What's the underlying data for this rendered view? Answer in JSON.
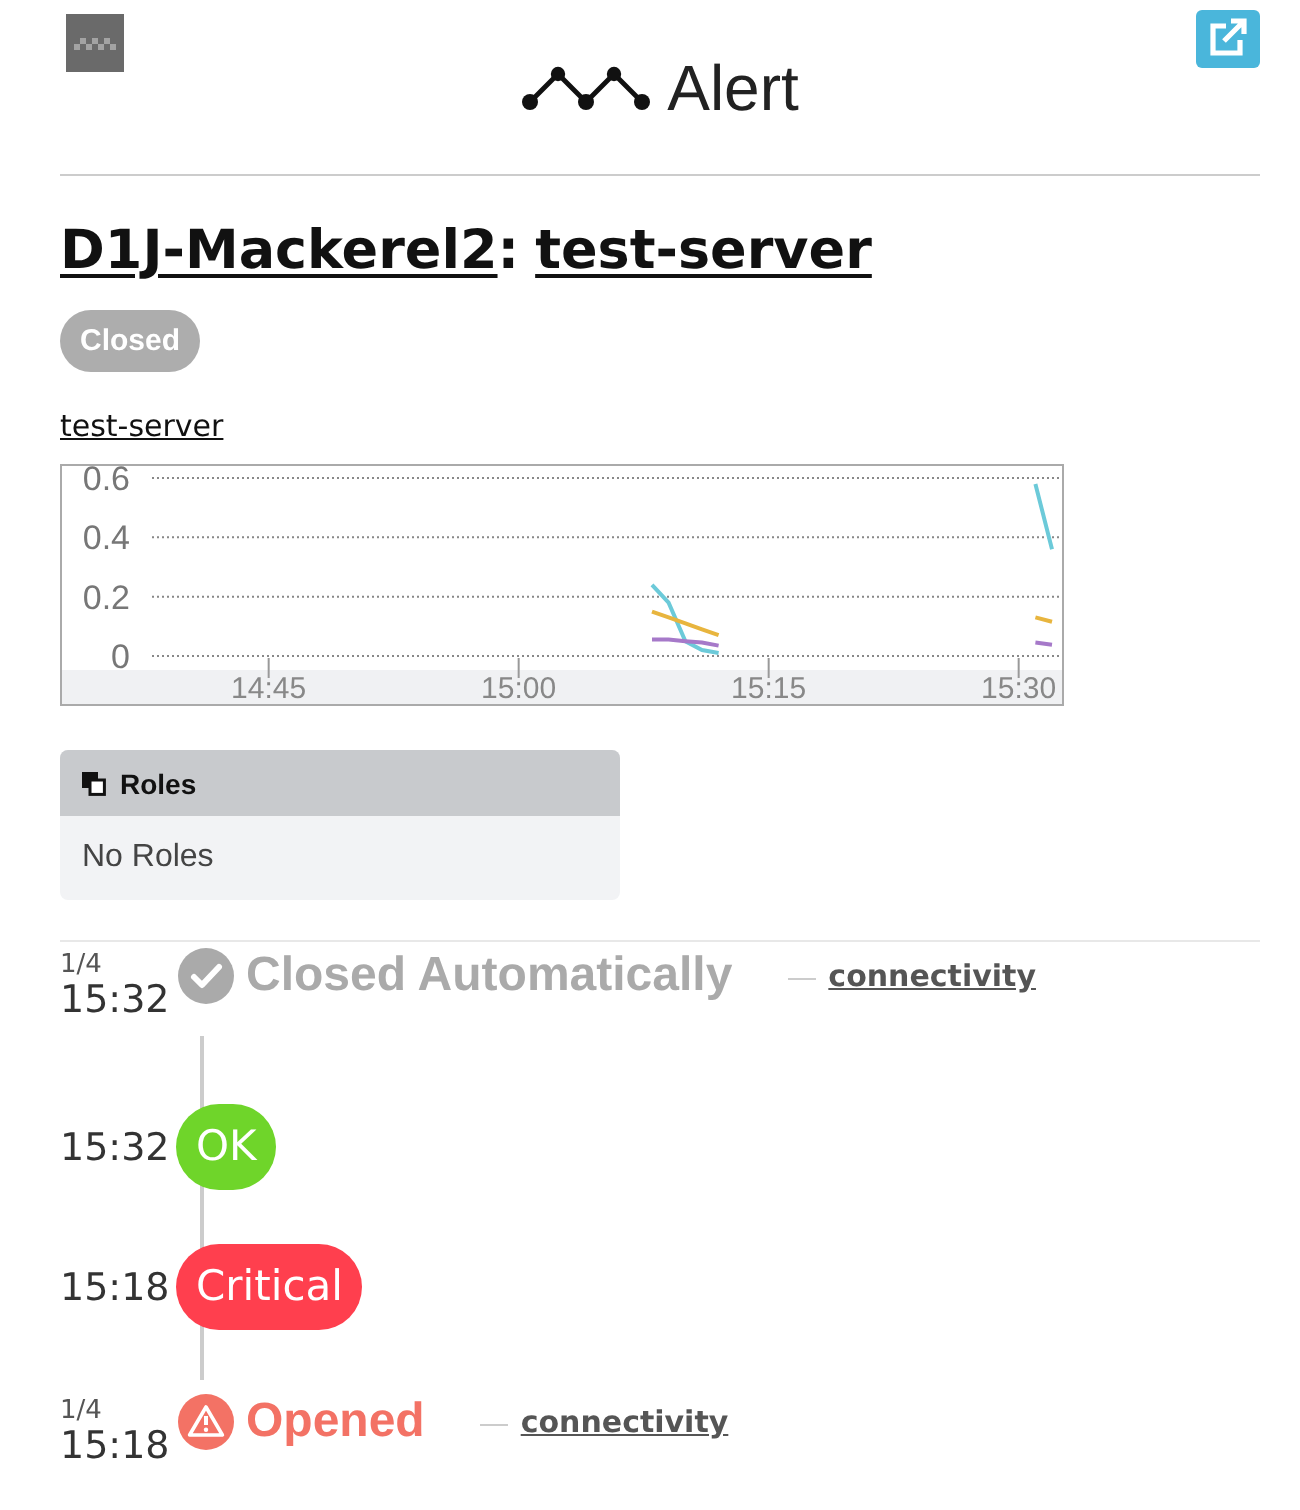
{
  "header": {
    "title": "Alert"
  },
  "alert": {
    "organization": "D1J-Mackerel2",
    "separator": ":",
    "host": "test-server",
    "status": {
      "kind": "closed",
      "label": "Closed"
    }
  },
  "graph": {
    "host_link": "test-server",
    "chart_data": {
      "type": "line",
      "categories": [
        null,
        null,
        null,
        null,
        null,
        null,
        null,
        "14:45",
        null,
        null,
        null,
        null,
        null,
        null,
        null,
        null,
        null,
        null,
        null,
        null,
        null,
        null,
        "15:00",
        null,
        null,
        null,
        null,
        null,
        null,
        null,
        null,
        null,
        null,
        null,
        null,
        null,
        null,
        "15:15",
        null,
        null,
        null,
        null,
        null,
        null,
        null,
        null,
        null,
        null,
        null,
        null,
        null,
        null,
        "15:30",
        null,
        null
      ],
      "ylim": [
        0,
        0.6
      ],
      "yticks": [
        0,
        0.2,
        0.4,
        0.6
      ],
      "series": [
        {
          "color": "#6ccad9",
          "values": [
            null,
            null,
            null,
            null,
            null,
            null,
            null,
            null,
            null,
            null,
            null,
            null,
            null,
            null,
            null,
            null,
            null,
            null,
            null,
            null,
            null,
            null,
            null,
            null,
            null,
            null,
            null,
            null,
            null,
            null,
            0.24,
            0.18,
            0.05,
            0.02,
            0.01,
            null,
            null,
            null,
            null,
            null,
            null,
            null,
            null,
            null,
            null,
            null,
            null,
            null,
            null,
            null,
            null,
            null,
            null,
            0.58,
            0.36
          ]
        },
        {
          "color": "#e8b53e",
          "values": [
            null,
            null,
            null,
            null,
            null,
            null,
            null,
            null,
            null,
            null,
            null,
            null,
            null,
            null,
            null,
            null,
            null,
            null,
            null,
            null,
            null,
            null,
            null,
            null,
            null,
            null,
            null,
            null,
            null,
            null,
            0.15,
            0.13,
            0.11,
            0.09,
            0.07,
            null,
            null,
            null,
            null,
            null,
            null,
            null,
            null,
            null,
            null,
            null,
            null,
            null,
            null,
            null,
            null,
            null,
            null,
            0.13,
            0.115
          ]
        },
        {
          "color": "#a679c9",
          "values": [
            null,
            null,
            null,
            null,
            null,
            null,
            null,
            null,
            null,
            null,
            null,
            null,
            null,
            null,
            null,
            null,
            null,
            null,
            null,
            null,
            null,
            null,
            null,
            null,
            null,
            null,
            null,
            null,
            null,
            null,
            0.055,
            0.055,
            0.05,
            0.045,
            0.035,
            null,
            null,
            null,
            null,
            null,
            null,
            null,
            null,
            null,
            null,
            null,
            null,
            null,
            null,
            null,
            null,
            null,
            null,
            0.045,
            0.038
          ]
        }
      ]
    }
  },
  "roles": {
    "title": "Roles",
    "empty_text": "No Roles"
  },
  "timeline": [
    {
      "kind": "closed",
      "date": "1/4",
      "time": "15:32",
      "label": "Closed Automatically",
      "monitor": "connectivity"
    },
    {
      "kind": "ok",
      "time": "15:32",
      "label": "OK"
    },
    {
      "kind": "critical",
      "time": "15:18",
      "label": "Critical"
    },
    {
      "kind": "opened",
      "date": "1/4",
      "time": "15:18",
      "label": "Opened",
      "monitor": "connectivity"
    }
  ]
}
